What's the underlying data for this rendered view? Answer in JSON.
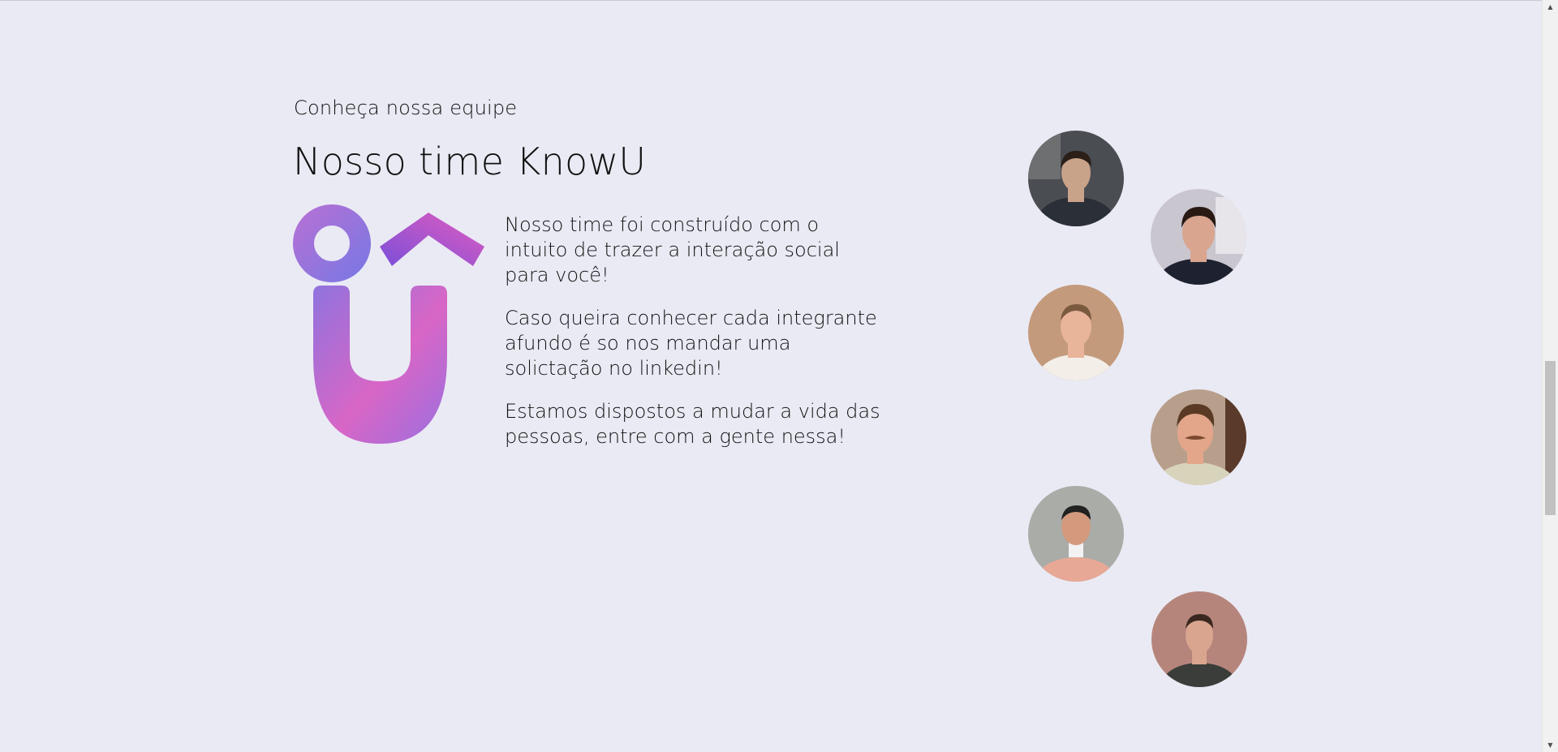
{
  "section": {
    "eyebrow": "Conheça nossa equipe",
    "title": "Nosso time KnowU",
    "paragraphs": [
      "Nosso time foi construído com o intuito de trazer a interação social para você!",
      "Caso queira conhecer cada integrante afundo é so nos mandar uma solictação no linkedin!",
      "Estamos dispostos a mudar a vida das pessoas, entre com a gente nessa!"
    ]
  },
  "logo": {
    "icon": "knowu-logo-icon",
    "gradient_start": "#8f6fe0",
    "gradient_mid": "#d465c8",
    "gradient_end": "#b26ad8"
  },
  "team": [
    {
      "name": "team-member-1",
      "shirt": "#2a2f38",
      "skin": "#c9a28a",
      "hair": "#2b1f18",
      "bg": "#4a4d52"
    },
    {
      "name": "team-member-2",
      "shirt": "#1e2230",
      "skin": "#d9a58f",
      "hair": "#2a1a14",
      "bg": "#c9c6cf"
    },
    {
      "name": "team-member-3",
      "shirt": "#f3eee8",
      "skin": "#e8b49a",
      "hair": "#7a5a3e",
      "bg": "#c49a7c"
    },
    {
      "name": "team-member-4",
      "shirt": "#d8d3bb",
      "skin": "#e3a68a",
      "hair": "#5a3a24",
      "bg": "#b89f8c"
    },
    {
      "name": "team-member-5",
      "shirt": "#e8a896",
      "skin": "#d39a7e",
      "hair": "#222",
      "bg": "#a9aca7"
    },
    {
      "name": "team-member-6",
      "shirt": "#3a3d3a",
      "skin": "#d9a58f",
      "hair": "#3a2820",
      "bg": "#b5857c"
    }
  ],
  "scrollbar": {
    "up_icon": "▲",
    "down_icon": "▼"
  }
}
